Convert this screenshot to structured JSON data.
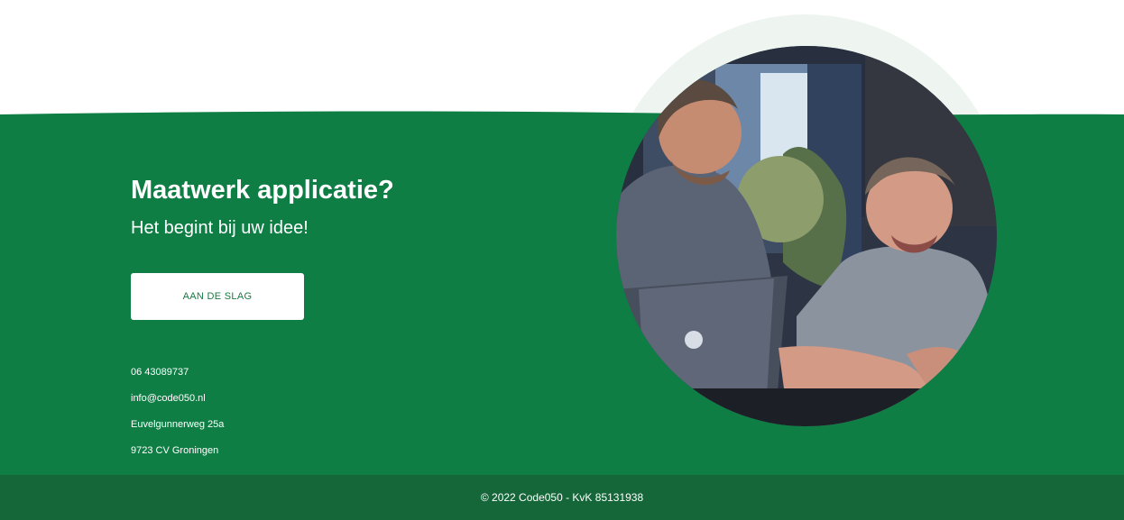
{
  "hero": {
    "title": "Maatwerk applicatie?",
    "subtitle": "Het begint bij uw idee!",
    "cta_label": "AAN DE SLAG"
  },
  "contact": {
    "phone": "06 43089737",
    "email": "info@code050.nl",
    "street": "Euvelgunnerweg 25a",
    "city": "9723 CV Groningen"
  },
  "footer": {
    "copyright": "© 2022 Code050 - KvK 85131938"
  },
  "colors": {
    "primary_green": "#0f7e45",
    "footer_green": "#15673a",
    "white": "#ffffff"
  }
}
